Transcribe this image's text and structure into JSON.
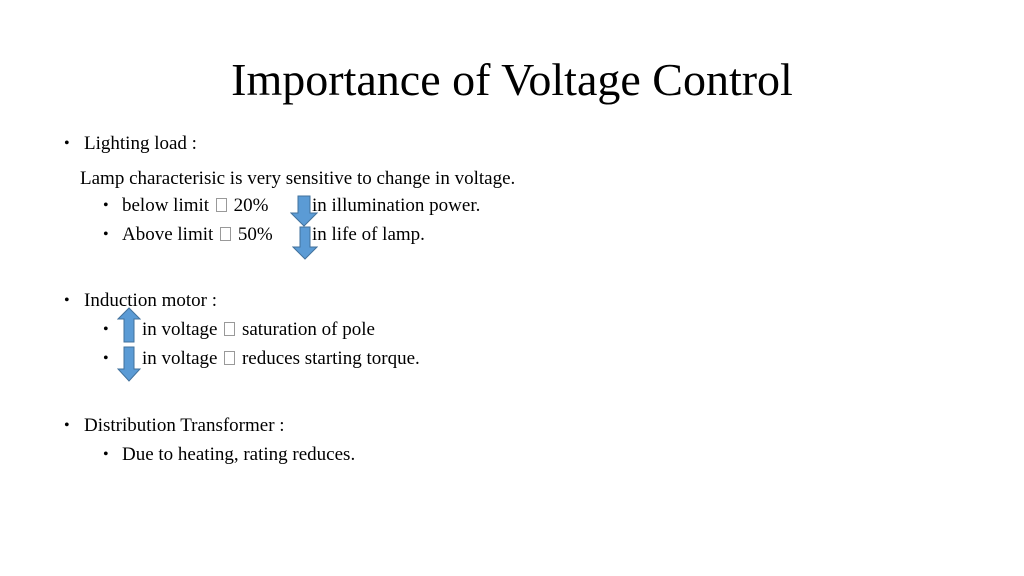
{
  "slide": {
    "title": "Importance of Voltage Control",
    "accent_color": "#5b9bd5",
    "sections": {
      "lighting": {
        "heading": "Lighting load :",
        "intro": "Lamp characterisic is very sensitive to change in voltage.",
        "items": [
          {
            "prefix": "below limit",
            "value": "20%",
            "arrow": "down-arrow",
            "suffix": "in illumination power."
          },
          {
            "prefix": "Above limit",
            "value": "50%",
            "arrow": "down-arrow",
            "suffix": "in life of lamp."
          }
        ]
      },
      "motor": {
        "heading": "Induction motor :",
        "items": [
          {
            "arrow": "up-arrow",
            "text": "in voltage",
            "suffix": "saturation of pole"
          },
          {
            "arrow": "down-arrow",
            "text": "in voltage",
            "suffix": "reduces starting torque."
          }
        ]
      },
      "transformer": {
        "heading": "Distribution Transformer :",
        "items": [
          {
            "text": "Due to heating, rating reduces."
          }
        ]
      }
    }
  }
}
